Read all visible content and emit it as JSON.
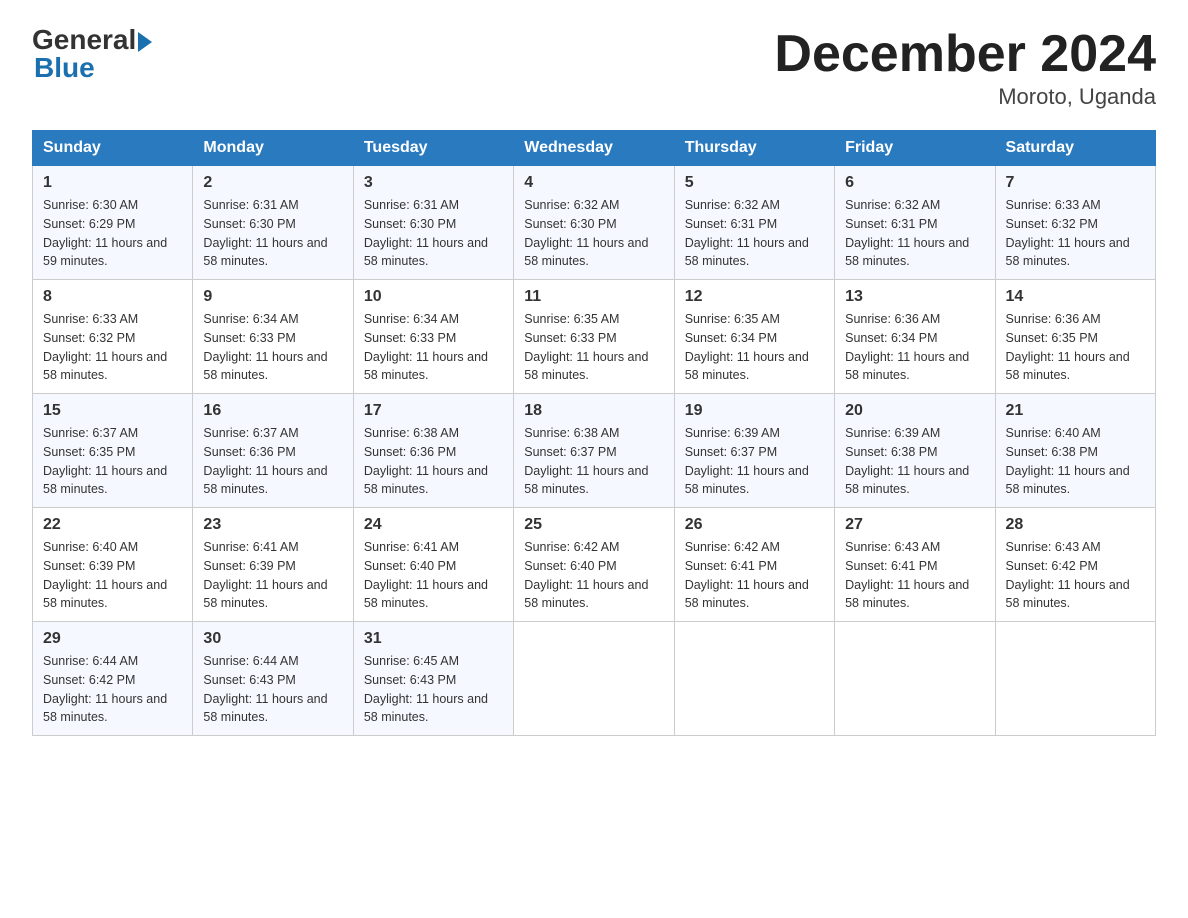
{
  "logo": {
    "general": "General",
    "blue": "Blue"
  },
  "title": "December 2024",
  "location": "Moroto, Uganda",
  "headers": [
    "Sunday",
    "Monday",
    "Tuesday",
    "Wednesday",
    "Thursday",
    "Friday",
    "Saturday"
  ],
  "weeks": [
    [
      {
        "day": "1",
        "sunrise": "6:30 AM",
        "sunset": "6:29 PM",
        "daylight": "11 hours and 59 minutes."
      },
      {
        "day": "2",
        "sunrise": "6:31 AM",
        "sunset": "6:30 PM",
        "daylight": "11 hours and 58 minutes."
      },
      {
        "day": "3",
        "sunrise": "6:31 AM",
        "sunset": "6:30 PM",
        "daylight": "11 hours and 58 minutes."
      },
      {
        "day": "4",
        "sunrise": "6:32 AM",
        "sunset": "6:30 PM",
        "daylight": "11 hours and 58 minutes."
      },
      {
        "day": "5",
        "sunrise": "6:32 AM",
        "sunset": "6:31 PM",
        "daylight": "11 hours and 58 minutes."
      },
      {
        "day": "6",
        "sunrise": "6:32 AM",
        "sunset": "6:31 PM",
        "daylight": "11 hours and 58 minutes."
      },
      {
        "day": "7",
        "sunrise": "6:33 AM",
        "sunset": "6:32 PM",
        "daylight": "11 hours and 58 minutes."
      }
    ],
    [
      {
        "day": "8",
        "sunrise": "6:33 AM",
        "sunset": "6:32 PM",
        "daylight": "11 hours and 58 minutes."
      },
      {
        "day": "9",
        "sunrise": "6:34 AM",
        "sunset": "6:33 PM",
        "daylight": "11 hours and 58 minutes."
      },
      {
        "day": "10",
        "sunrise": "6:34 AM",
        "sunset": "6:33 PM",
        "daylight": "11 hours and 58 minutes."
      },
      {
        "day": "11",
        "sunrise": "6:35 AM",
        "sunset": "6:33 PM",
        "daylight": "11 hours and 58 minutes."
      },
      {
        "day": "12",
        "sunrise": "6:35 AM",
        "sunset": "6:34 PM",
        "daylight": "11 hours and 58 minutes."
      },
      {
        "day": "13",
        "sunrise": "6:36 AM",
        "sunset": "6:34 PM",
        "daylight": "11 hours and 58 minutes."
      },
      {
        "day": "14",
        "sunrise": "6:36 AM",
        "sunset": "6:35 PM",
        "daylight": "11 hours and 58 minutes."
      }
    ],
    [
      {
        "day": "15",
        "sunrise": "6:37 AM",
        "sunset": "6:35 PM",
        "daylight": "11 hours and 58 minutes."
      },
      {
        "day": "16",
        "sunrise": "6:37 AM",
        "sunset": "6:36 PM",
        "daylight": "11 hours and 58 minutes."
      },
      {
        "day": "17",
        "sunrise": "6:38 AM",
        "sunset": "6:36 PM",
        "daylight": "11 hours and 58 minutes."
      },
      {
        "day": "18",
        "sunrise": "6:38 AM",
        "sunset": "6:37 PM",
        "daylight": "11 hours and 58 minutes."
      },
      {
        "day": "19",
        "sunrise": "6:39 AM",
        "sunset": "6:37 PM",
        "daylight": "11 hours and 58 minutes."
      },
      {
        "day": "20",
        "sunrise": "6:39 AM",
        "sunset": "6:38 PM",
        "daylight": "11 hours and 58 minutes."
      },
      {
        "day": "21",
        "sunrise": "6:40 AM",
        "sunset": "6:38 PM",
        "daylight": "11 hours and 58 minutes."
      }
    ],
    [
      {
        "day": "22",
        "sunrise": "6:40 AM",
        "sunset": "6:39 PM",
        "daylight": "11 hours and 58 minutes."
      },
      {
        "day": "23",
        "sunrise": "6:41 AM",
        "sunset": "6:39 PM",
        "daylight": "11 hours and 58 minutes."
      },
      {
        "day": "24",
        "sunrise": "6:41 AM",
        "sunset": "6:40 PM",
        "daylight": "11 hours and 58 minutes."
      },
      {
        "day": "25",
        "sunrise": "6:42 AM",
        "sunset": "6:40 PM",
        "daylight": "11 hours and 58 minutes."
      },
      {
        "day": "26",
        "sunrise": "6:42 AM",
        "sunset": "6:41 PM",
        "daylight": "11 hours and 58 minutes."
      },
      {
        "day": "27",
        "sunrise": "6:43 AM",
        "sunset": "6:41 PM",
        "daylight": "11 hours and 58 minutes."
      },
      {
        "day": "28",
        "sunrise": "6:43 AM",
        "sunset": "6:42 PM",
        "daylight": "11 hours and 58 minutes."
      }
    ],
    [
      {
        "day": "29",
        "sunrise": "6:44 AM",
        "sunset": "6:42 PM",
        "daylight": "11 hours and 58 minutes."
      },
      {
        "day": "30",
        "sunrise": "6:44 AM",
        "sunset": "6:43 PM",
        "daylight": "11 hours and 58 minutes."
      },
      {
        "day": "31",
        "sunrise": "6:45 AM",
        "sunset": "6:43 PM",
        "daylight": "11 hours and 58 minutes."
      },
      null,
      null,
      null,
      null
    ]
  ]
}
